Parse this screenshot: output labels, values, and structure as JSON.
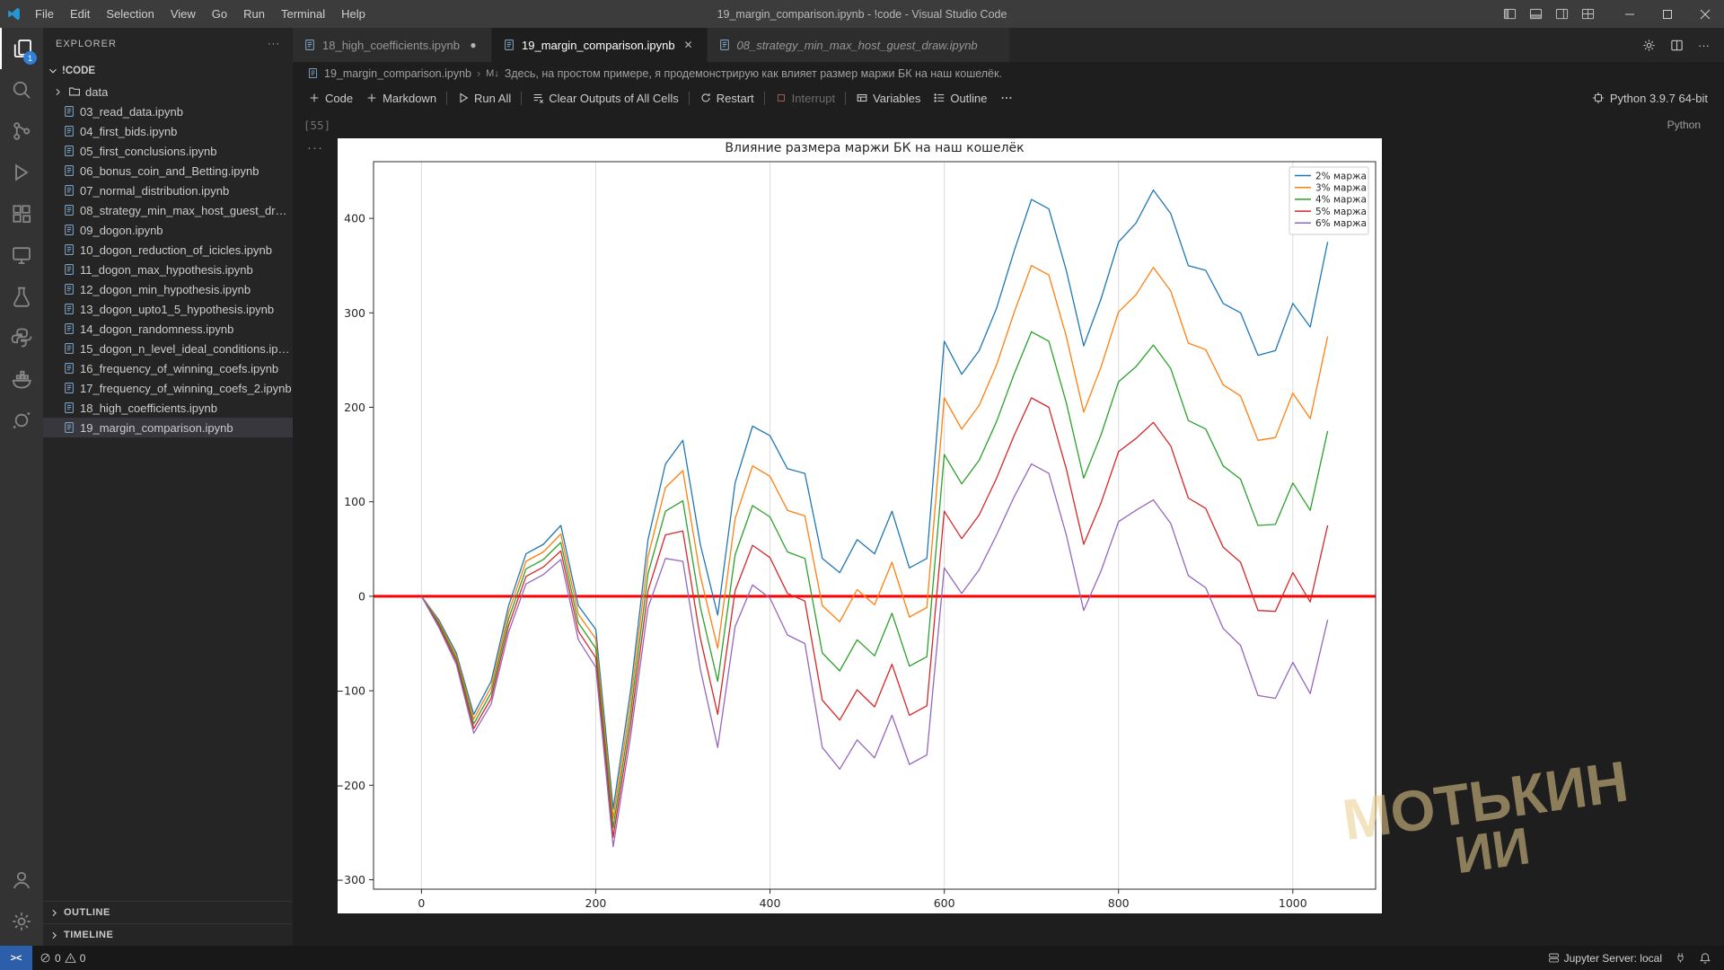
{
  "window": {
    "title": "19_margin_comparison.ipynb - !code - Visual Studio Code",
    "menus": [
      "File",
      "Edit",
      "Selection",
      "View",
      "Go",
      "Run",
      "Terminal",
      "Help"
    ]
  },
  "activity_bar": {
    "badge": "1",
    "items": [
      "explorer",
      "search",
      "source-control",
      "run-debug",
      "extensions",
      "remote-explorer",
      "testing",
      "python",
      "docker",
      "jupyter"
    ]
  },
  "sidebar": {
    "header": "EXPLORER",
    "section": "!CODE",
    "folder": "data",
    "files": [
      "03_read_data.ipynb",
      "04_first_bids.ipynb",
      "05_first_conclusions.ipynb",
      "06_bonus_coin_and_Betting.ipynb",
      "07_normal_distribution.ipynb",
      "08_strategy_min_max_host_guest_draw.ipynb",
      "09_dogon.ipynb",
      "10_dogon_reduction_of_icicles.ipynb",
      "11_dogon_max_hypothesis.ipynb",
      "12_dogon_min_hypothesis.ipynb",
      "13_dogon_upto1_5_hypothesis.ipynb",
      "14_dogon_randomness.ipynb",
      "15_dogon_n_level_ideal_conditions.ipynb",
      "16_frequency_of_winning_coefs.ipynb",
      "17_frequency_of_winning_coefs_2.ipynb",
      "18_high_coefficients.ipynb",
      "19_margin_comparison.ipynb"
    ],
    "selected": "19_margin_comparison.ipynb",
    "bottom_sections": [
      "OUTLINE",
      "TIMELINE"
    ]
  },
  "tabs": [
    {
      "label": "18_high_coefficients.ipynb",
      "state": "modified"
    },
    {
      "label": "19_margin_comparison.ipynb",
      "state": "active"
    },
    {
      "label": "08_strategy_min_max_host_guest_draw.ipynb",
      "state": "preview"
    }
  ],
  "breadcrumb": {
    "file": "19_margin_comparison.ipynb",
    "cell_marker": "M↓",
    "cell_text": "Здесь, на простом примере, я продемонстрирую как влияет размер маржи БК на наш кошелёк."
  },
  "nb_toolbar": {
    "groups": [
      {
        "items": [
          {
            "icon": "plus",
            "label": "Code"
          },
          {
            "icon": "plus",
            "label": "Markdown"
          }
        ]
      },
      {
        "items": [
          {
            "icon": "play",
            "label": "Run All"
          }
        ]
      },
      {
        "items": [
          {
            "icon": "clear",
            "label": "Clear Outputs of All Cells"
          }
        ]
      },
      {
        "items": [
          {
            "icon": "restart",
            "label": "Restart"
          }
        ]
      },
      {
        "items": [
          {
            "icon": "interrupt",
            "label": "Interrupt",
            "disabled": true
          }
        ]
      },
      {
        "items": [
          {
            "icon": "variables",
            "label": "Variables"
          },
          {
            "icon": "outline",
            "label": "Outline"
          },
          {
            "icon": "ellipsis",
            "label": ""
          }
        ]
      }
    ],
    "kernel": "Python 3.9.7 64-bit"
  },
  "cell": {
    "execution_count": "[55]",
    "language": "Python"
  },
  "chart_data": {
    "type": "line",
    "title": "Влияние размера маржи БК на наш кошелёк",
    "xlabel": "",
    "ylabel": "",
    "xlim": [
      -55,
      1095
    ],
    "ylim": [
      -310,
      460
    ],
    "xticks": [
      0,
      200,
      400,
      600,
      800,
      1000
    ],
    "yticks": [
      -300,
      -200,
      -100,
      0,
      100,
      200,
      300,
      400
    ],
    "grid": "vertical-only",
    "legend_position": "upper right",
    "axhline": {
      "y": 0,
      "color": "#ff0000"
    },
    "x": [
      0,
      20,
      40,
      60,
      80,
      100,
      120,
      140,
      160,
      180,
      200,
      220,
      240,
      260,
      280,
      300,
      320,
      340,
      360,
      380,
      400,
      420,
      440,
      460,
      480,
      500,
      520,
      540,
      560,
      580,
      600,
      620,
      640,
      660,
      680,
      700,
      720,
      740,
      760,
      780,
      800,
      820,
      840,
      860,
      880,
      900,
      920,
      940,
      960,
      980,
      1000,
      1020,
      1040
    ],
    "series": [
      {
        "name": "2% маржа",
        "color": "#1f77b4",
        "values": [
          0,
          -25,
          -60,
          -125,
          -90,
          -10,
          45,
          55,
          75,
          -10,
          -35,
          -225,
          -100,
          60,
          140,
          165,
          55,
          -20,
          120,
          180,
          170,
          135,
          130,
          40,
          25,
          60,
          45,
          90,
          30,
          40,
          270,
          235,
          260,
          305,
          365,
          420,
          410,
          345,
          265,
          315,
          375,
          395,
          430,
          405,
          350,
          345,
          310,
          300,
          255,
          260,
          310,
          285,
          375
        ]
      },
      {
        "name": "3% маржа",
        "color": "#ff7f0e",
        "values": [
          0,
          -27,
          -63,
          -130,
          -96,
          -17,
          37,
          47,
          66,
          -19,
          -45,
          -235,
          -112,
          42,
          115,
          133,
          22,
          -55,
          82,
          138,
          127,
          91,
          85,
          -10,
          -27,
          7,
          -9,
          36,
          -22,
          -12,
          210,
          177,
          202,
          245,
          300,
          350,
          340,
          275,
          195,
          243,
          301,
          319,
          348,
          323,
          268,
          261,
          224,
          212,
          165,
          168,
          215,
          188,
          275
        ]
      },
      {
        "name": "4% маржа",
        "color": "#2ca02c",
        "values": [
          0,
          -29,
          -66,
          -135,
          -102,
          -24,
          29,
          39,
          57,
          -28,
          -55,
          -245,
          -124,
          24,
          90,
          101,
          -11,
          -90,
          44,
          96,
          84,
          47,
          40,
          -60,
          -79,
          -46,
          -63,
          -18,
          -74,
          -64,
          150,
          119,
          144,
          185,
          235,
          280,
          270,
          205,
          125,
          171,
          227,
          243,
          266,
          241,
          186,
          177,
          138,
          124,
          75,
          76,
          120,
          91,
          175
        ]
      },
      {
        "name": "5% маржа",
        "color": "#d62728",
        "values": [
          0,
          -31,
          -69,
          -140,
          -108,
          -31,
          21,
          31,
          48,
          -37,
          -65,
          -255,
          -136,
          6,
          65,
          69,
          -44,
          -125,
          6,
          54,
          41,
          3,
          -5,
          -110,
          -131,
          -99,
          -117,
          -72,
          -126,
          -116,
          90,
          61,
          86,
          125,
          170,
          210,
          200,
          135,
          55,
          99,
          153,
          167,
          184,
          159,
          104,
          93,
          52,
          36,
          -15,
          -16,
          25,
          -6,
          75
        ]
      },
      {
        "name": "6% маржа",
        "color": "#9467bd",
        "values": [
          0,
          -33,
          -72,
          -145,
          -114,
          -38,
          13,
          23,
          39,
          -46,
          -75,
          -265,
          -148,
          -12,
          40,
          37,
          -77,
          -160,
          -32,
          12,
          -2,
          -41,
          -50,
          -160,
          -183,
          -152,
          -171,
          -126,
          -178,
          -168,
          30,
          3,
          28,
          65,
          105,
          140,
          130,
          65,
          -15,
          27,
          79,
          91,
          102,
          77,
          22,
          9,
          -34,
          -52,
          -105,
          -108,
          -70,
          -103,
          -25
        ]
      }
    ]
  },
  "watermark": {
    "line1": "МОТЬКИН",
    "line2": "ИИ"
  },
  "status_bar": {
    "remote": "><",
    "errors": "0",
    "warnings": "0",
    "jupyter": "Jupyter Server: local"
  }
}
